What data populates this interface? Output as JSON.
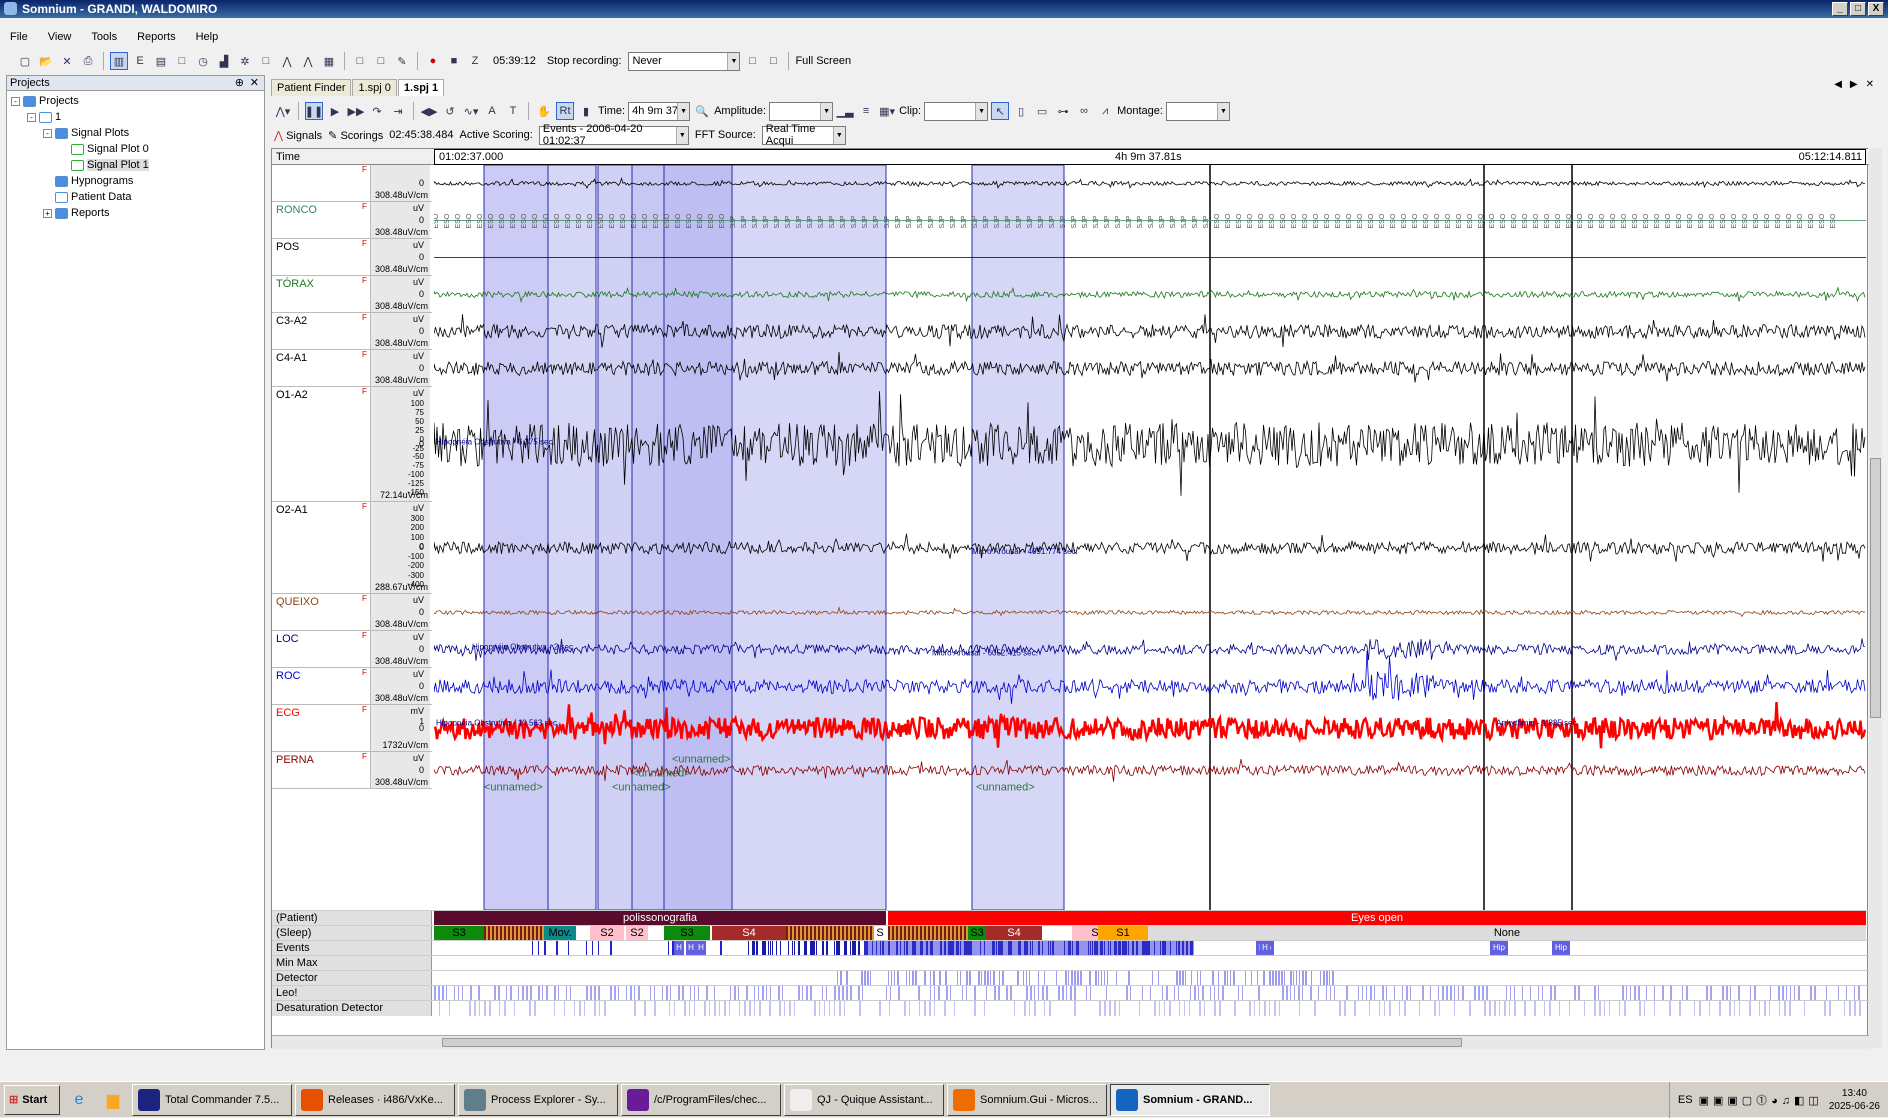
{
  "window": {
    "title": "Somnium - GRANDI, WALDOMIRO",
    "buttons": {
      "min": "_",
      "max": "□",
      "close": "X"
    }
  },
  "menu": [
    "File",
    "View",
    "Tools",
    "Reports",
    "Help"
  ],
  "toolbar1": {
    "time": "05:39:12",
    "stop_label": "Stop recording:",
    "stop_value": "Never",
    "fullscreen": "Full Screen"
  },
  "projects": {
    "header": "Projects",
    "tree": [
      {
        "label": "Projects",
        "level": 0,
        "icon": "folder-icon",
        "exp": "-"
      },
      {
        "label": "1",
        "level": 1,
        "icon": "flask-icon",
        "exp": "-"
      },
      {
        "label": "Signal Plots",
        "level": 2,
        "icon": "folder-icon",
        "exp": "-"
      },
      {
        "label": "Signal Plot 0",
        "level": 3,
        "icon": "signal-icon",
        "exp": ""
      },
      {
        "label": "Signal Plot 1",
        "level": 3,
        "icon": "signal-icon",
        "exp": "",
        "selected": true
      },
      {
        "label": "Hypnograms",
        "level": 2,
        "icon": "folder-icon",
        "exp": ""
      },
      {
        "label": "Patient Data",
        "level": 2,
        "icon": "info-icon",
        "exp": ""
      },
      {
        "label": "Reports",
        "level": 2,
        "icon": "folder-icon",
        "exp": "+"
      }
    ]
  },
  "tabs": [
    {
      "label": "Patient Finder"
    },
    {
      "label": "1.spj 0"
    },
    {
      "label": "1.spj 1",
      "active": true
    }
  ],
  "toolbar2": {
    "time_label": "Time:",
    "time_value": "4h 9m 37.8",
    "amplitude_label": "Amplitude:",
    "clip_label": "Clip:",
    "montage_label": "Montage:"
  },
  "toolbar3": {
    "signals": "Signals",
    "scorings": "Scorings",
    "clock": "02:45:38.484",
    "active_scoring_label": "Active Scoring:",
    "active_scoring_value": "Events - 2006-04-20 01:02:37",
    "fft_label": "FFT Source:",
    "fft_value": "Real Time Acqui"
  },
  "timebar": {
    "label": "Time",
    "start": "01:02:37.000",
    "middle": "4h 9m 37.81s",
    "end": "05:12:14.811"
  },
  "channels": [
    {
      "name": "",
      "unit": "",
      "zero": "0",
      "cal": "308.48uV/cm",
      "color": "#000000"
    },
    {
      "name": "RONCO",
      "unit": "uV",
      "zero": "0",
      "cal": "308.48uV/cm",
      "color": "#2e8b57"
    },
    {
      "name": "POS",
      "unit": "uV",
      "zero": "0",
      "cal": "308.48uV/cm",
      "color": "#000000"
    },
    {
      "name": "TÓRAX",
      "unit": "uV",
      "zero": "0",
      "cal": "308.48uV/cm",
      "color": "#1a7a1a"
    },
    {
      "name": "C3-A2",
      "unit": "uV",
      "zero": "0",
      "cal": "308.48uV/cm",
      "color": "#000000"
    },
    {
      "name": "C4-A1",
      "unit": "uV",
      "zero": "0",
      "cal": "308.48uV/cm",
      "color": "#000000"
    },
    {
      "name": "O1-A2",
      "unit": "uV",
      "zero": "0",
      "cal": "72.14uV/cm",
      "color": "#000000",
      "ticks": [
        "100",
        "75",
        "50",
        "25",
        "0",
        "-25",
        "-50",
        "-75",
        "-100",
        "-125",
        "-150"
      ]
    },
    {
      "name": "O2-A1",
      "unit": "uV",
      "zero": "0",
      "cal": "288.67uV/cm",
      "color": "#000000",
      "ticks": [
        "300",
        "200",
        "100",
        "0",
        "-100",
        "-200",
        "-300",
        "-400"
      ]
    },
    {
      "name": "QUEIXO",
      "unit": "uV",
      "zero": "0",
      "cal": "308.48uV/cm",
      "color": "#8b4513"
    },
    {
      "name": "LOC",
      "unit": "uV",
      "zero": "0",
      "cal": "308.48uV/cm",
      "color": "#00008b"
    },
    {
      "name": "ROC",
      "unit": "uV",
      "zero": "0",
      "cal": "308.48uV/cm",
      "color": "#0000cd"
    },
    {
      "name": "ECG",
      "unit": "mV",
      "zero": "0",
      "cal": "1732uV/cm",
      "color": "#ff0000",
      "ticks": [
        "1"
      ]
    },
    {
      "name": "PERNA",
      "unit": "uV",
      "zero": "0",
      "cal": "308.48uV/cm",
      "color": "#8b0000"
    }
  ],
  "annotations": {
    "hypo1": "Hipopnéia Obstrutiva - 6.375 sec.",
    "micro1": "Micro Arousal - 4091.774 sec.",
    "hypo2": "Hipopnéia Obstrutiva - 2 sec.",
    "micro2": "Micro Arousal - 6052.415 sec.",
    "hypo3": "Hipopnéia Obstrutiva - 10.563 sec.",
    "arrhythmia": "Arrhythmia - 1.835 sec.",
    "unnamed": "<unnamed>",
    "eso": "ESO",
    "sjp": "SJP"
  },
  "rows": {
    "patient": {
      "label": "(Patient)",
      "poly": "polissonografia",
      "eyes": "Eyes open"
    },
    "sleep": {
      "label": "(Sleep)",
      "stages": [
        "S3",
        "Mov.",
        "S2",
        "S2",
        "S3",
        "S4",
        "S",
        "S3",
        "S4",
        "S2",
        "S1",
        "None"
      ]
    },
    "events": {
      "label": "Events",
      "hip": "Hip",
      "h": "H"
    },
    "minmax": {
      "label": "Min Max"
    },
    "detector": {
      "label": "Detector"
    },
    "leo": {
      "label": "Leo!"
    },
    "desat": {
      "label": "Desaturation Detector"
    }
  },
  "taskbar": {
    "start": "Start",
    "tasks": [
      {
        "label": "Total Commander 7.5...",
        "color": "#1a237e"
      },
      {
        "label": "Releases · i486/VxKe...",
        "color": "#e65100"
      },
      {
        "label": "Process Explorer - Sy...",
        "color": "#607d8b"
      },
      {
        "label": "/c/ProgramFiles/chec...",
        "color": "#6a1b9a"
      },
      {
        "label": "QJ - Quique Assistant...",
        "color": "#eeeeee"
      },
      {
        "label": "Somnium.Gui - Micros...",
        "color": "#ef6c00"
      },
      {
        "label": "Somnium - GRAND...",
        "color": "#1565c0",
        "active": true
      }
    ],
    "lang": "ES",
    "time": "13:40",
    "date": "2025-06-26"
  }
}
